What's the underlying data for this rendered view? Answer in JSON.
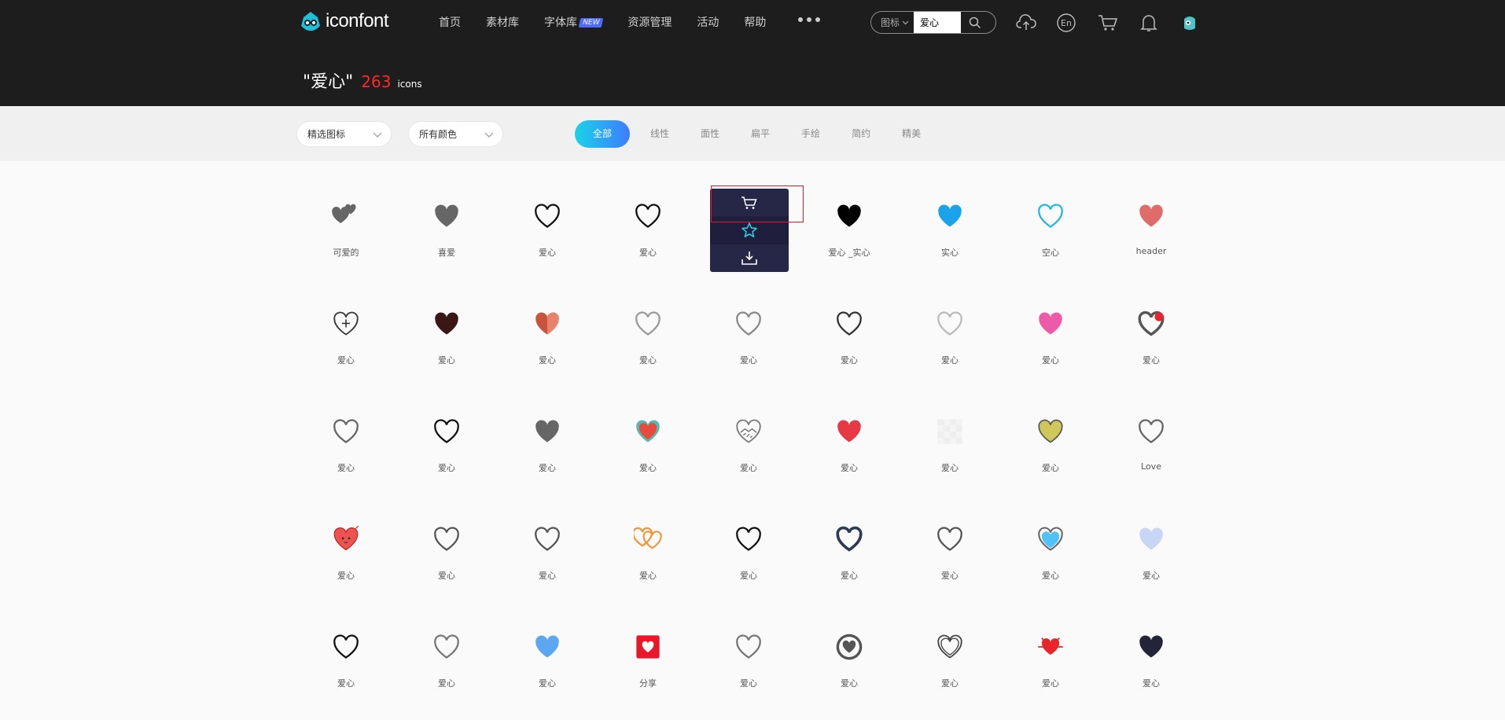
{
  "header": {
    "logo_text": "iconfont",
    "nav": [
      {
        "label": "首页"
      },
      {
        "label": "素材库"
      },
      {
        "label": "字体库",
        "badge": "NEW"
      },
      {
        "label": "资源管理"
      },
      {
        "label": "活动"
      },
      {
        "label": "帮助"
      }
    ],
    "search": {
      "type": "图标",
      "value": "爱心"
    },
    "icons": [
      "upload-cloud-icon",
      "language-en-icon",
      "cart-icon",
      "bell-icon",
      "user-avatar"
    ],
    "lang_label": "En"
  },
  "title": {
    "query": "\"爱心\"",
    "count": "263",
    "unit": "icons"
  },
  "filters": {
    "select1": "精选图标",
    "select2": "所有颜色",
    "tabs": [
      "全部",
      "线性",
      "面性",
      "扁平",
      "手绘",
      "简约",
      "精美"
    ],
    "active_tab": "全部"
  },
  "hover_actions": [
    "cart-icon",
    "star-icon",
    "download-icon"
  ],
  "icons": [
    {
      "label": "可爱的",
      "kind": "double",
      "color": "#666666"
    },
    {
      "label": "喜爱",
      "kind": "fill",
      "color": "#666666"
    },
    {
      "label": "爱心",
      "kind": "outline",
      "color": "#111111"
    },
    {
      "label": "爱心",
      "kind": "outline",
      "color": "#111111"
    },
    {
      "label": "",
      "kind": "hover",
      "color": "#262647"
    },
    {
      "label": "爱心 _实心",
      "kind": "fill",
      "color": "#000000"
    },
    {
      "label": "实心",
      "kind": "fill",
      "color": "#1aa3e8"
    },
    {
      "label": "空心",
      "kind": "outline",
      "color": "#27b5e8"
    },
    {
      "label": "header",
      "kind": "fill",
      "color": "#e06b6b"
    },
    {
      "label": "爱心",
      "kind": "plus",
      "color": "#333333"
    },
    {
      "label": "爱心",
      "kind": "fill",
      "color": "#3a1614"
    },
    {
      "label": "爱心",
      "kind": "split",
      "color": "#c9533d"
    },
    {
      "label": "爱心",
      "kind": "outline",
      "color": "#999999"
    },
    {
      "label": "爱心",
      "kind": "outline",
      "color": "#888888"
    },
    {
      "label": "爱心",
      "kind": "outline",
      "color": "#333333"
    },
    {
      "label": "爱心",
      "kind": "outline",
      "color": "#bbbbbb"
    },
    {
      "label": "爱心",
      "kind": "fill",
      "color": "#ee5aa8"
    },
    {
      "label": "爱心",
      "kind": "badge",
      "color": "#555555"
    },
    {
      "label": "爱心",
      "kind": "outline",
      "color": "#666666"
    },
    {
      "label": "爱心",
      "kind": "outline",
      "color": "#111111"
    },
    {
      "label": "爱心",
      "kind": "fill",
      "color": "#666666"
    },
    {
      "label": "爱心",
      "kind": "teal",
      "color": "#e84a3c"
    },
    {
      "label": "爱心",
      "kind": "hands",
      "color": "#777777"
    },
    {
      "label": "爱心",
      "kind": "fill",
      "color": "#e63946"
    },
    {
      "label": "爱心",
      "kind": "blank",
      "color": "#eeeeee"
    },
    {
      "label": "爱心",
      "kind": "olive",
      "color": "#cfc75a"
    },
    {
      "label": "Love",
      "kind": "outline",
      "color": "#666666"
    },
    {
      "label": "爱心",
      "kind": "cute",
      "color": "#ef5350"
    },
    {
      "label": "爱心",
      "kind": "outline",
      "color": "#555555"
    },
    {
      "label": "爱心",
      "kind": "outline",
      "color": "#555555"
    },
    {
      "label": "爱心",
      "kind": "rings",
      "color": "#f0963a"
    },
    {
      "label": "爱心",
      "kind": "outline",
      "color": "#111111"
    },
    {
      "label": "爱心",
      "kind": "thick",
      "color": "#2b3a55"
    },
    {
      "label": "爱心",
      "kind": "outline",
      "color": "#555555"
    },
    {
      "label": "爱心",
      "kind": "bluefill",
      "color": "#4fc3f7"
    },
    {
      "label": "爱心",
      "kind": "fill",
      "color": "#c7d6f5"
    },
    {
      "label": "爱心",
      "kind": "outline",
      "color": "#111111"
    },
    {
      "label": "爱心",
      "kind": "outline",
      "color": "#777777"
    },
    {
      "label": "爱心",
      "kind": "fill",
      "color": "#5ca6f2"
    },
    {
      "label": "分享",
      "kind": "square",
      "color": "#e8172a"
    },
    {
      "label": "爱心",
      "kind": "outline",
      "color": "#777777"
    },
    {
      "label": "爱心",
      "kind": "circle",
      "color": "#555555"
    },
    {
      "label": "爱心",
      "kind": "double-outline",
      "color": "#444444"
    },
    {
      "label": "爱心",
      "kind": "spark",
      "color": "#e8252a"
    },
    {
      "label": "爱心",
      "kind": "fill",
      "color": "#232438"
    }
  ]
}
